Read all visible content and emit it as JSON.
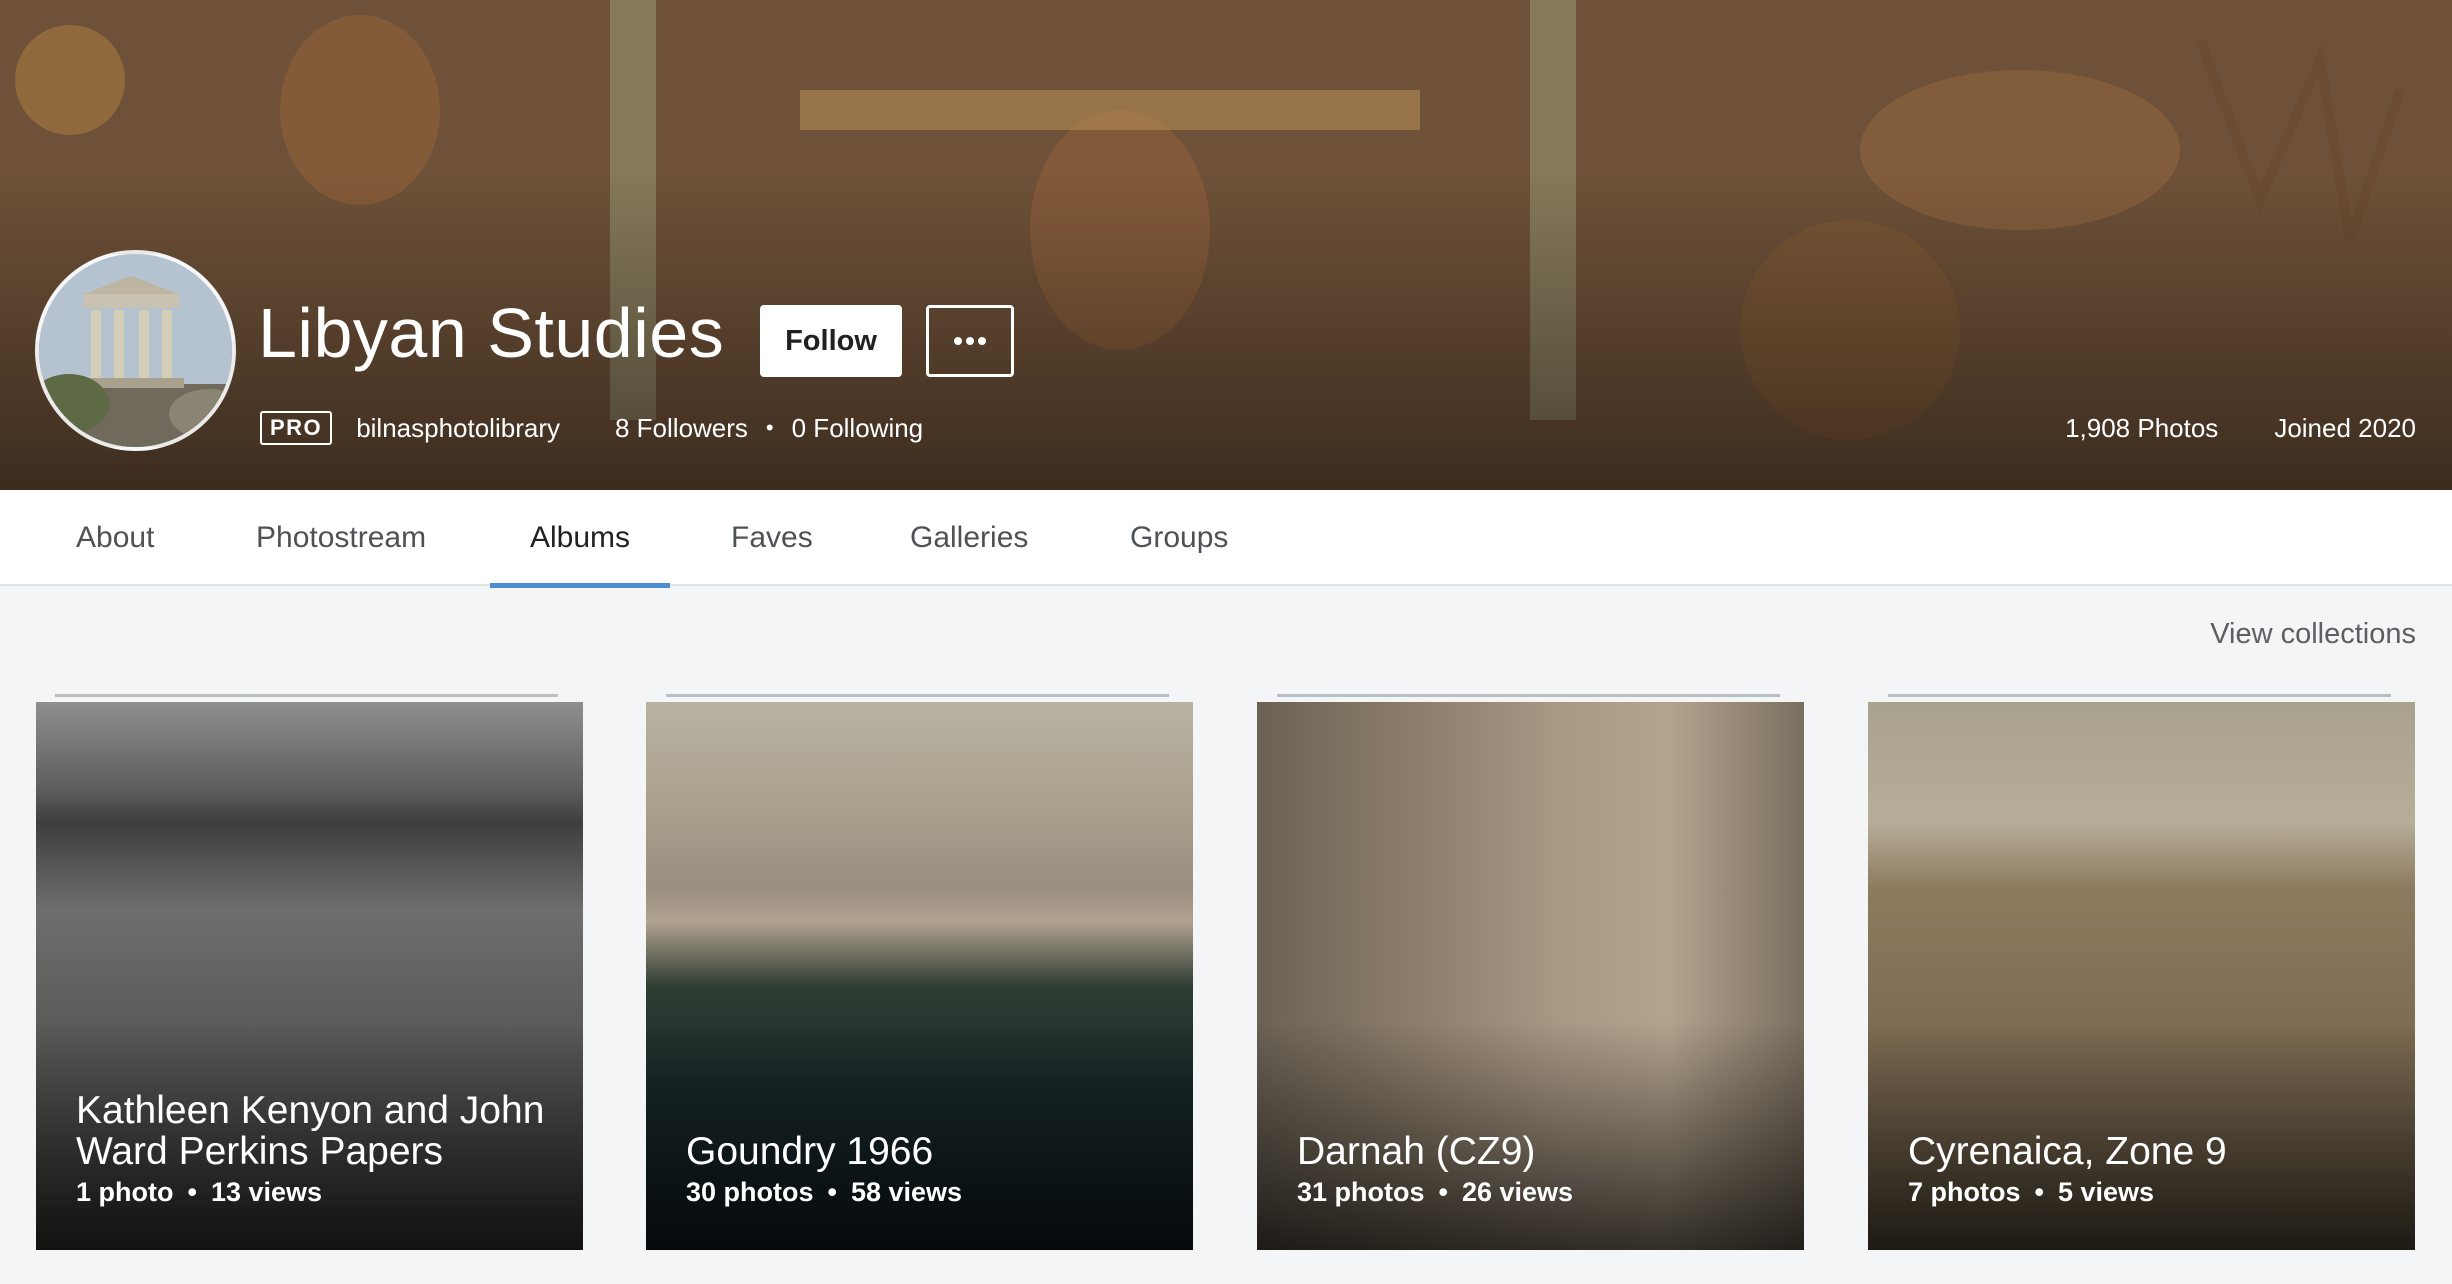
{
  "header": {
    "title": "Libyan Studies",
    "follow_label": "Follow",
    "more_label": "•••",
    "pro_badge": "PRO",
    "username": "bilnasphotolibrary",
    "followers": "8 Followers",
    "following": "0 Following",
    "separator": "•",
    "photos_count": "1,908 Photos",
    "joined": "Joined 2020"
  },
  "tabs": [
    {
      "label": "About"
    },
    {
      "label": "Photostream"
    },
    {
      "label": "Albums",
      "active": true
    },
    {
      "label": "Faves"
    },
    {
      "label": "Galleries"
    },
    {
      "label": "Groups"
    }
  ],
  "view_collections": "View collections",
  "albums": [
    {
      "title": "Kathleen Kenyon and John Ward Perkins Papers",
      "photos": "1 photo",
      "views": "13 views"
    },
    {
      "title": "Goundry 1966",
      "photos": "30 photos",
      "views": "58 views"
    },
    {
      "title": "Darnah (CZ9)",
      "photos": "31 photos",
      "views": "26 views"
    },
    {
      "title": "Cyrenaica, Zone 9",
      "photos": "7 photos",
      "views": "5 views"
    }
  ],
  "colors": {
    "accent_tab": "#4b8fd1",
    "page_bg": "#f3f5f6",
    "text_primary": "#212124"
  }
}
